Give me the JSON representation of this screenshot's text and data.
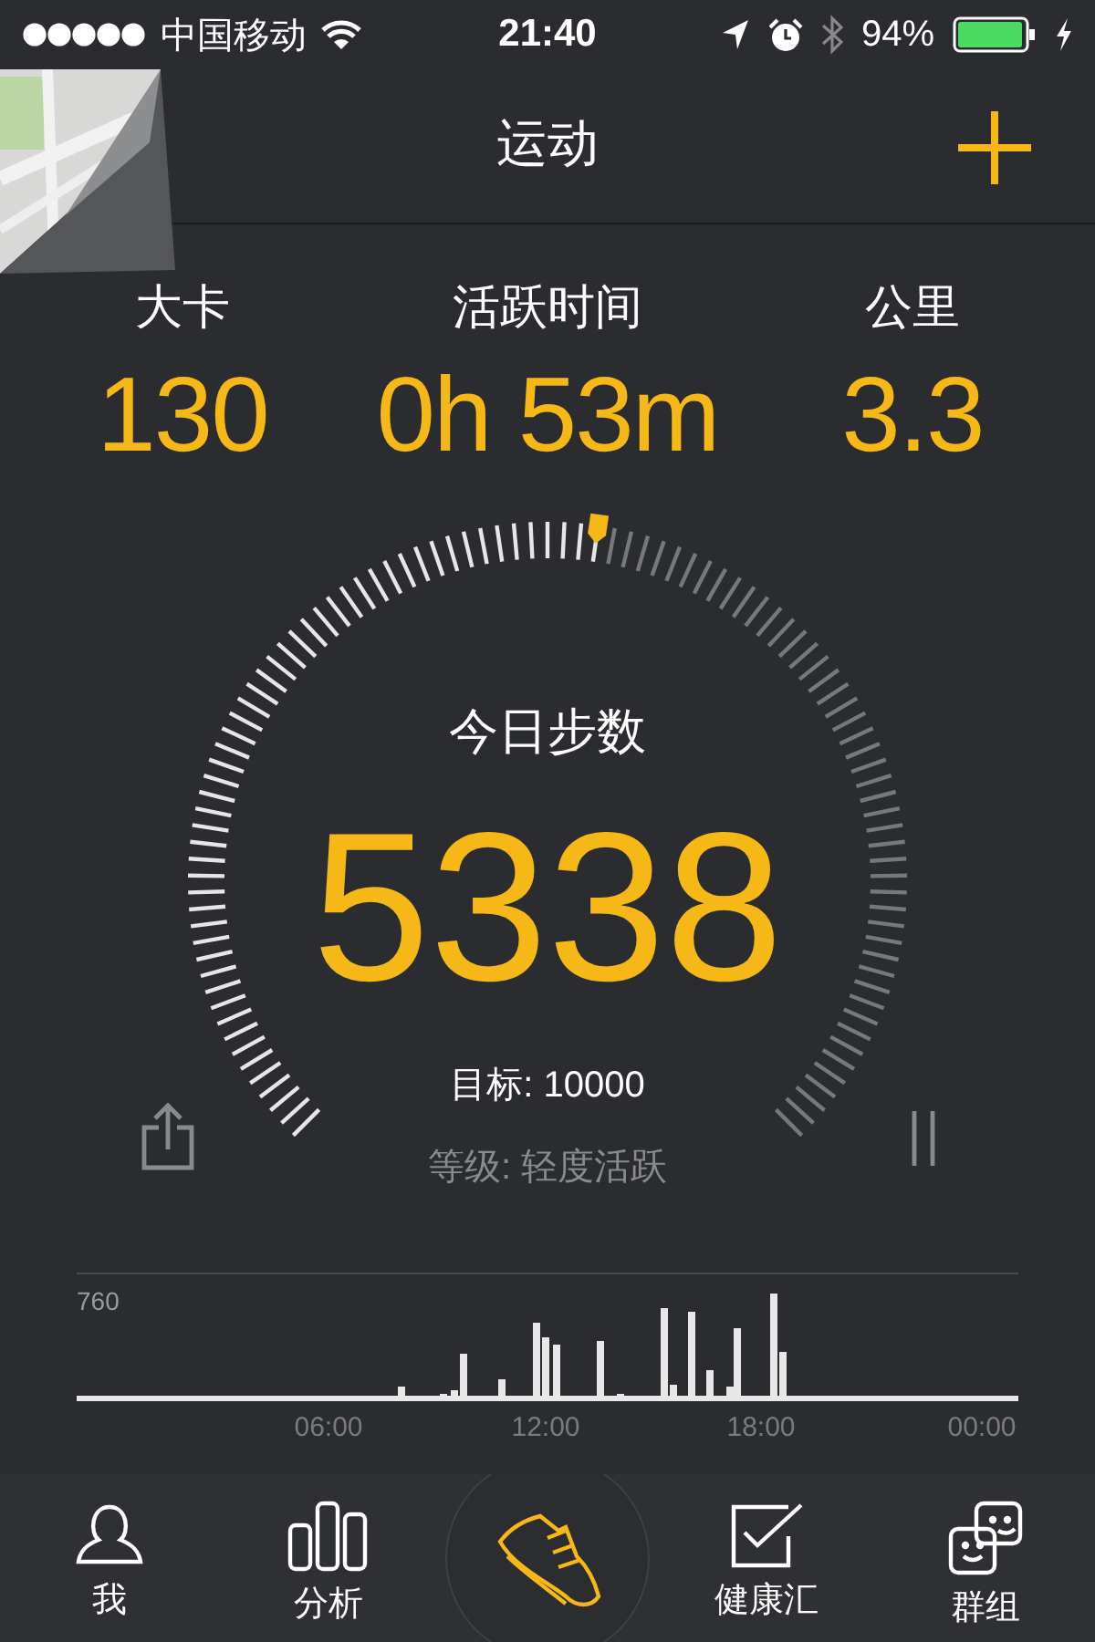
{
  "status_bar": {
    "carrier": "中国移动",
    "time": "21:40",
    "battery": "94%"
  },
  "nav": {
    "title": "运动"
  },
  "stats": [
    {
      "label": "大卡",
      "value": "130"
    },
    {
      "label": "活跃时间",
      "value": "0h 53m"
    },
    {
      "label": "公里",
      "value": "3.3"
    }
  ],
  "gauge": {
    "title": "今日步数",
    "steps": "5338",
    "goal": "目标: 10000",
    "grade": "等级: 轻度活跃"
  },
  "chart": {
    "y_label": "760",
    "x_labels": [
      "06:00",
      "12:00",
      "18:00",
      "00:00"
    ]
  },
  "tabs": [
    {
      "kind": "person",
      "label": "我",
      "selected": false
    },
    {
      "kind": "bars",
      "label": "分析",
      "selected": false
    },
    {
      "kind": "shoe",
      "selected": true
    },
    {
      "kind": "check",
      "label": "健康汇",
      "selected": false
    },
    {
      "kind": "faces",
      "label": "群组",
      "selected": false
    }
  ]
}
